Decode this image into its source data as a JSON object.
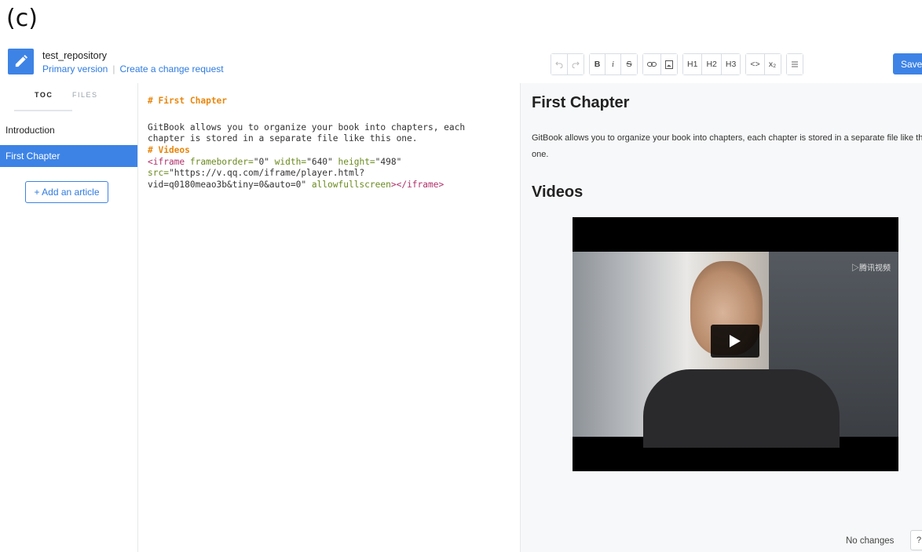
{
  "figure_label": "(c)",
  "header": {
    "repo_name": "test_repository",
    "version_link": "Primary version",
    "change_request_link": "Create a change request",
    "accent_color": "#3d83e6"
  },
  "toolbar": {
    "undo_icon": "undo-icon",
    "redo_icon": "redo-icon",
    "bold": "B",
    "italic": "i",
    "strikethrough": "S",
    "link_icon": "link-icon",
    "image_icon": "image-icon",
    "h1": "H1",
    "h2": "H2",
    "h3": "H3",
    "code": "<>",
    "subscript": "x₂",
    "list_icon": "list-icon",
    "save_label": "Save"
  },
  "sidebar": {
    "tabs": {
      "toc": "TOC",
      "files": "FILES"
    },
    "items": [
      {
        "label": "Introduction",
        "active": false
      },
      {
        "label": "First Chapter",
        "active": true
      }
    ],
    "add_article": "+ Add an article"
  },
  "editor": {
    "line1": "# First Chapter",
    "line2": "GitBook allows you to organize your book into chapters, each",
    "line3": "chapter is stored in a separate file like this one.",
    "line4": "# Videos",
    "line5_tag_open": "<iframe",
    "line5_attr1": " frameborder=",
    "line5_val1": "\"0\"",
    "line5_attr2": " width=",
    "line5_val2": "\"640\"",
    "line5_attr3": " height=",
    "line5_val3": "\"498\"",
    "line6_attr": "src=",
    "line6_val": "\"https://v.qq.com/iframe/player.html?",
    "line7_val": "vid=q0180meao3b&tiny=0&auto=0\"",
    "line7_attr": " allowfullscreen",
    "line7_tag_close": "></iframe>"
  },
  "preview": {
    "h1": "First Chapter",
    "paragraph": "GitBook allows you to organize your book into chapters, each chapter is stored in a separate file like this one.",
    "h2": "Videos",
    "video_watermark": "▷腾讯视频",
    "status": "No changes",
    "help": "?"
  }
}
